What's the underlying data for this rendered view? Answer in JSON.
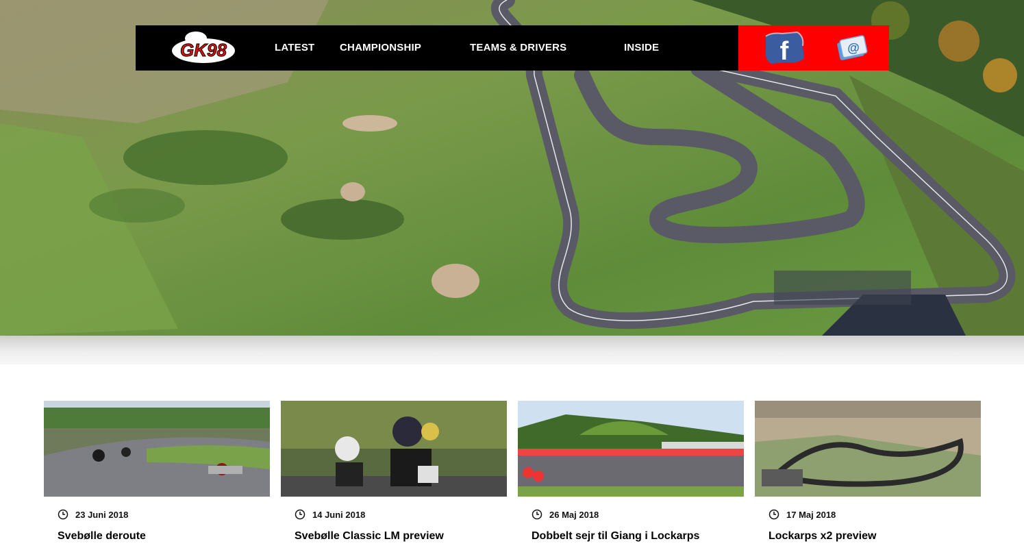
{
  "nav": {
    "logo_alt": "GK98",
    "items": [
      {
        "label": "LATEST"
      },
      {
        "label": "CHAMPIONSHIP"
      },
      {
        "label": "TEAMS & DRIVERS"
      },
      {
        "label": "INSIDE"
      }
    ]
  },
  "social": {
    "facebook_icon": "facebook-icon",
    "email_icon": "email-icon"
  },
  "posts": [
    {
      "date": "23 Juni 2018",
      "title": "Svebølle deroute"
    },
    {
      "date": "14 Juni 2018",
      "title": "Svebølle Classic LM preview"
    },
    {
      "date": "26 Maj 2018",
      "title": "Dobbelt sejr til Giang i Lockarps"
    },
    {
      "date": "17 Maj 2018",
      "title": "Lockarps x2 preview"
    }
  ],
  "colors": {
    "nav_bg": "#000000",
    "social_bg": "#ff0000",
    "accent": "#e31010"
  }
}
